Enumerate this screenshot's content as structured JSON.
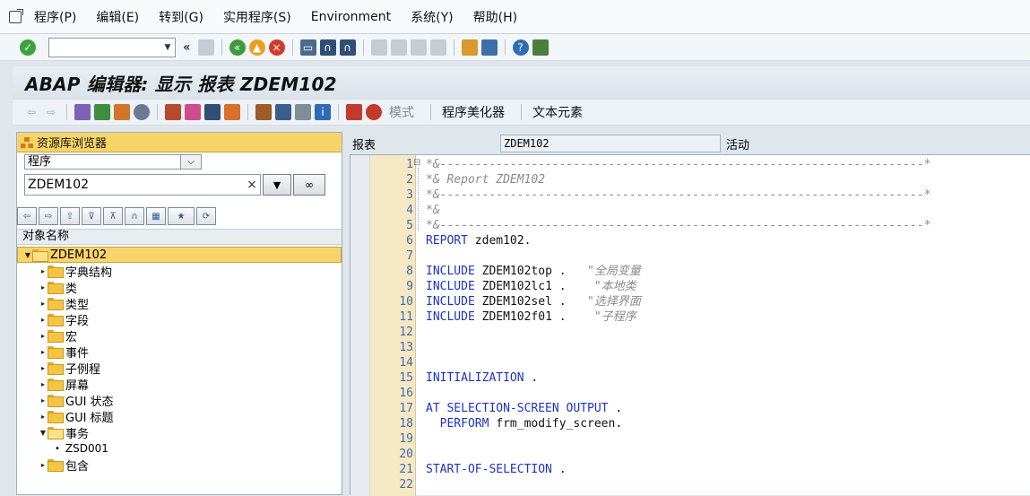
{
  "menu": {
    "items": [
      "程序(P)",
      "编辑(E)",
      "转到(G)",
      "实用程序(S)",
      "Environment",
      "系统(Y)",
      "帮助(H)"
    ]
  },
  "toolbar": {
    "command_value": ""
  },
  "title": "ABAP 编辑器: 显示 报表 ZDEM102",
  "app_toolbar": {
    "mode_label": "模式",
    "pretty_printer_label": "程序美化器",
    "text_elements_label": "文本元素"
  },
  "repository_browser": {
    "header": "资源库浏览器",
    "object_type": "程序",
    "object_name": "ZDEM102",
    "tree_header": "对象名称",
    "tree": [
      {
        "label": "ZDEM102",
        "level": 0,
        "expanded": true,
        "selected": true
      },
      {
        "label": "字典结构",
        "level": 1,
        "expanded": false
      },
      {
        "label": "类",
        "level": 1,
        "expanded": false
      },
      {
        "label": "类型",
        "level": 1,
        "expanded": false
      },
      {
        "label": "字段",
        "level": 1,
        "expanded": false
      },
      {
        "label": "宏",
        "level": 1,
        "expanded": false
      },
      {
        "label": "事件",
        "level": 1,
        "expanded": false
      },
      {
        "label": "子例程",
        "level": 1,
        "expanded": false
      },
      {
        "label": "屏幕",
        "level": 1,
        "expanded": false
      },
      {
        "label": "GUI 状态",
        "level": 1,
        "expanded": false
      },
      {
        "label": "GUI 标题",
        "level": 1,
        "expanded": false
      },
      {
        "label": "事务",
        "level": 1,
        "expanded": true
      },
      {
        "label": "ZSD001",
        "level": 2,
        "leaf": true
      },
      {
        "label": "包含",
        "level": 1,
        "expanded": false
      }
    ]
  },
  "program_header": {
    "type_label": "报表",
    "program_name": "ZDEM102",
    "status": "活动"
  },
  "code_lines": [
    {
      "n": "1",
      "text": "*&---------------------------------------------------------------------*",
      "cls": "cmt"
    },
    {
      "n": "2",
      "text": "*& Report ZDEM102",
      "cls": "cmt"
    },
    {
      "n": "3",
      "text": "*&---------------------------------------------------------------------*",
      "cls": "cmt"
    },
    {
      "n": "4",
      "text": "*&",
      "cls": "cmt"
    },
    {
      "n": "5",
      "text": "*&---------------------------------------------------------------------*",
      "cls": "cmt"
    },
    {
      "n": "6",
      "parts": [
        {
          "t": "REPORT",
          "c": "kw"
        },
        {
          "t": " zdem102.",
          "c": "plain"
        }
      ]
    },
    {
      "n": "7",
      "text": "",
      "cls": "plain"
    },
    {
      "n": "8",
      "parts": [
        {
          "t": "INCLUDE",
          "c": "kw"
        },
        {
          "t": " ZDEM102top .  ",
          "c": "plain"
        },
        {
          "t": " \"全局变量",
          "c": "cmt"
        }
      ]
    },
    {
      "n": "9",
      "parts": [
        {
          "t": "INCLUDE",
          "c": "kw"
        },
        {
          "t": " ZDEM102lc1 .  ",
          "c": "plain"
        },
        {
          "t": "  \"本地类",
          "c": "cmt"
        }
      ]
    },
    {
      "n": "10",
      "parts": [
        {
          "t": "INCLUDE",
          "c": "kw"
        },
        {
          "t": " ZDEM102sel .  ",
          "c": "plain"
        },
        {
          "t": " \"选择界面",
          "c": "cmt"
        }
      ]
    },
    {
      "n": "11",
      "parts": [
        {
          "t": "INCLUDE",
          "c": "kw"
        },
        {
          "t": " ZDEM102f01 .  ",
          "c": "plain"
        },
        {
          "t": "  \"子程序",
          "c": "cmt"
        }
      ]
    },
    {
      "n": "12",
      "text": "",
      "cls": "plain"
    },
    {
      "n": "13",
      "text": "",
      "cls": "plain"
    },
    {
      "n": "14",
      "text": "",
      "cls": "plain"
    },
    {
      "n": "15",
      "parts": [
        {
          "t": "INITIALIZATION",
          "c": "kw"
        },
        {
          "t": " .",
          "c": "plain"
        }
      ]
    },
    {
      "n": "16",
      "text": "",
      "cls": "plain"
    },
    {
      "n": "17",
      "parts": [
        {
          "t": "AT SELECTION-SCREEN OUTPUT",
          "c": "kw"
        },
        {
          "t": " .",
          "c": "plain"
        }
      ]
    },
    {
      "n": "18",
      "parts": [
        {
          "t": "  PERFORM",
          "c": "kw"
        },
        {
          "t": " frm_modify_screen.",
          "c": "plain"
        }
      ]
    },
    {
      "n": "19",
      "text": "",
      "cls": "plain"
    },
    {
      "n": "20",
      "text": "",
      "cls": "plain"
    },
    {
      "n": "21",
      "parts": [
        {
          "t": "START-OF-SELECTION",
          "c": "kw"
        },
        {
          "t": " .",
          "c": "plain"
        }
      ]
    },
    {
      "n": "22",
      "text": "",
      "cls": "plain"
    }
  ]
}
